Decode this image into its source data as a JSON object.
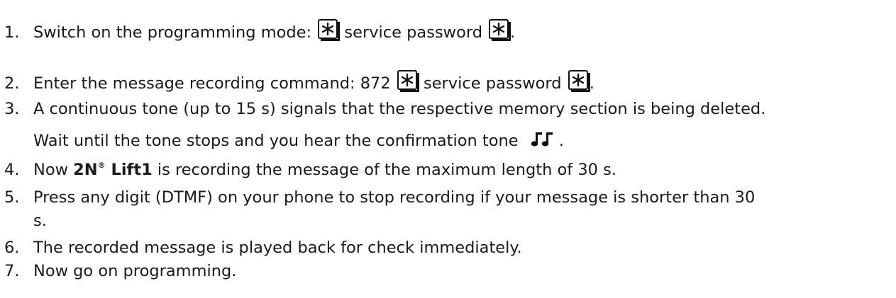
{
  "steps": [
    {
      "number": "1.",
      "text_a": "Switch on the programming mode: ",
      "text_b": " service password ",
      "text_c": "."
    },
    {
      "number": "2.",
      "text_a": "Enter the message recording command: 872 ",
      "text_b": " service password ",
      "text_c": "."
    },
    {
      "number": "3.",
      "text_a": "A continuous tone (up to 15 s) signals that the respective memory section is being deleted.",
      "text_cont": "Wait until the tone stops and you hear the confirmation tone ",
      "text_end": "."
    },
    {
      "number": "4.",
      "text_a": "Now ",
      "brand": "2N",
      "reg": "®",
      "brand_b": " Lift1",
      "text_b": " is recording the message of the maximum length of 30 s."
    },
    {
      "number": "5.",
      "text_a": "Press any digit (DTMF) on your phone to stop recording if your message is shorter than 30",
      "text_cont": "s."
    },
    {
      "number": "6.",
      "text_a": "The recorded message is played back for check immediately."
    },
    {
      "number": "7.",
      "text_a": "Now go on programming."
    }
  ],
  "icons": {
    "star_key": "star-key-icon",
    "confirmation_tone": "double-note-icon"
  }
}
